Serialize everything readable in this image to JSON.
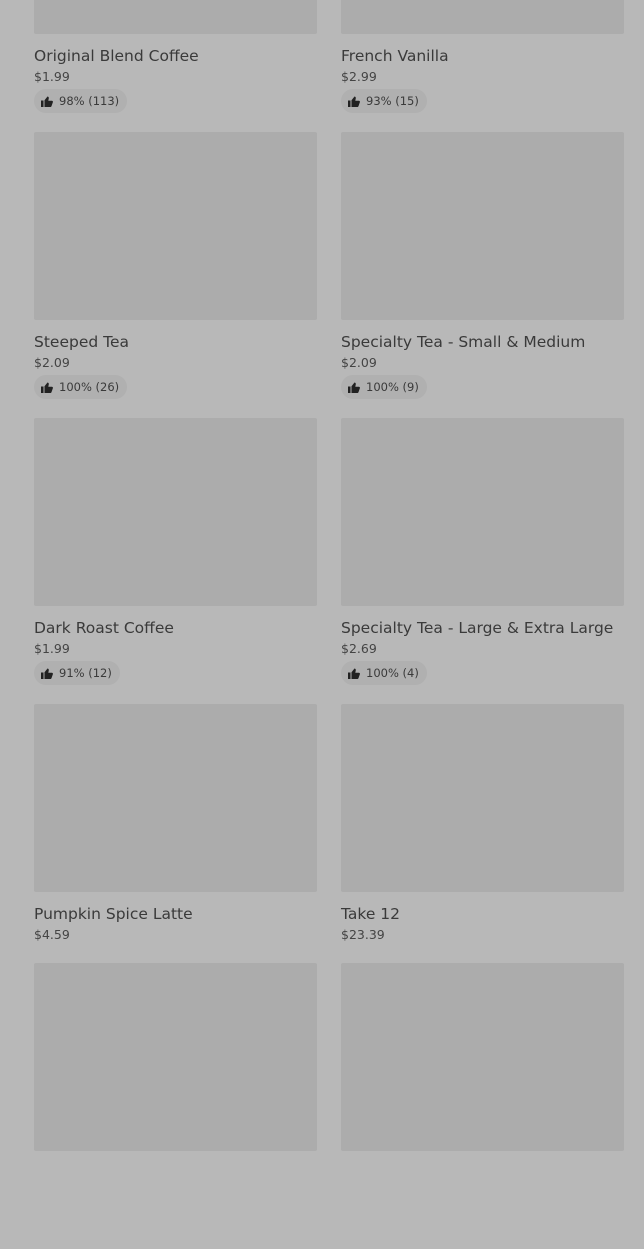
{
  "products": [
    {
      "name": "Original Blend Coffee",
      "price": "$1.99",
      "rating": "98% (113)"
    },
    {
      "name": "French Vanilla",
      "price": "$2.99",
      "rating": "93% (15)"
    },
    {
      "name": "Steeped Tea",
      "price": "$2.09",
      "rating": "100% (26)"
    },
    {
      "name": "Specialty Tea - Small & Medium",
      "price": "$2.09",
      "rating": "100% (9)"
    },
    {
      "name": "Dark Roast Coffee",
      "price": "$1.99",
      "rating": "91% (12)"
    },
    {
      "name": "Specialty Tea - Large & Extra Large",
      "price": "$2.69",
      "rating": "100% (4)"
    },
    {
      "name": "Pumpkin Spice Latte",
      "price": "$4.59",
      "rating": ""
    },
    {
      "name": "Take 12",
      "price": "$23.39",
      "rating": ""
    },
    {
      "name": "",
      "price": "",
      "rating": ""
    },
    {
      "name": "",
      "price": "",
      "rating": ""
    }
  ],
  "icons": {
    "rating": "thumbs-up-icon"
  },
  "colors": {
    "overlay_background": "#b8b8b8",
    "image_placeholder": "#acacac"
  }
}
